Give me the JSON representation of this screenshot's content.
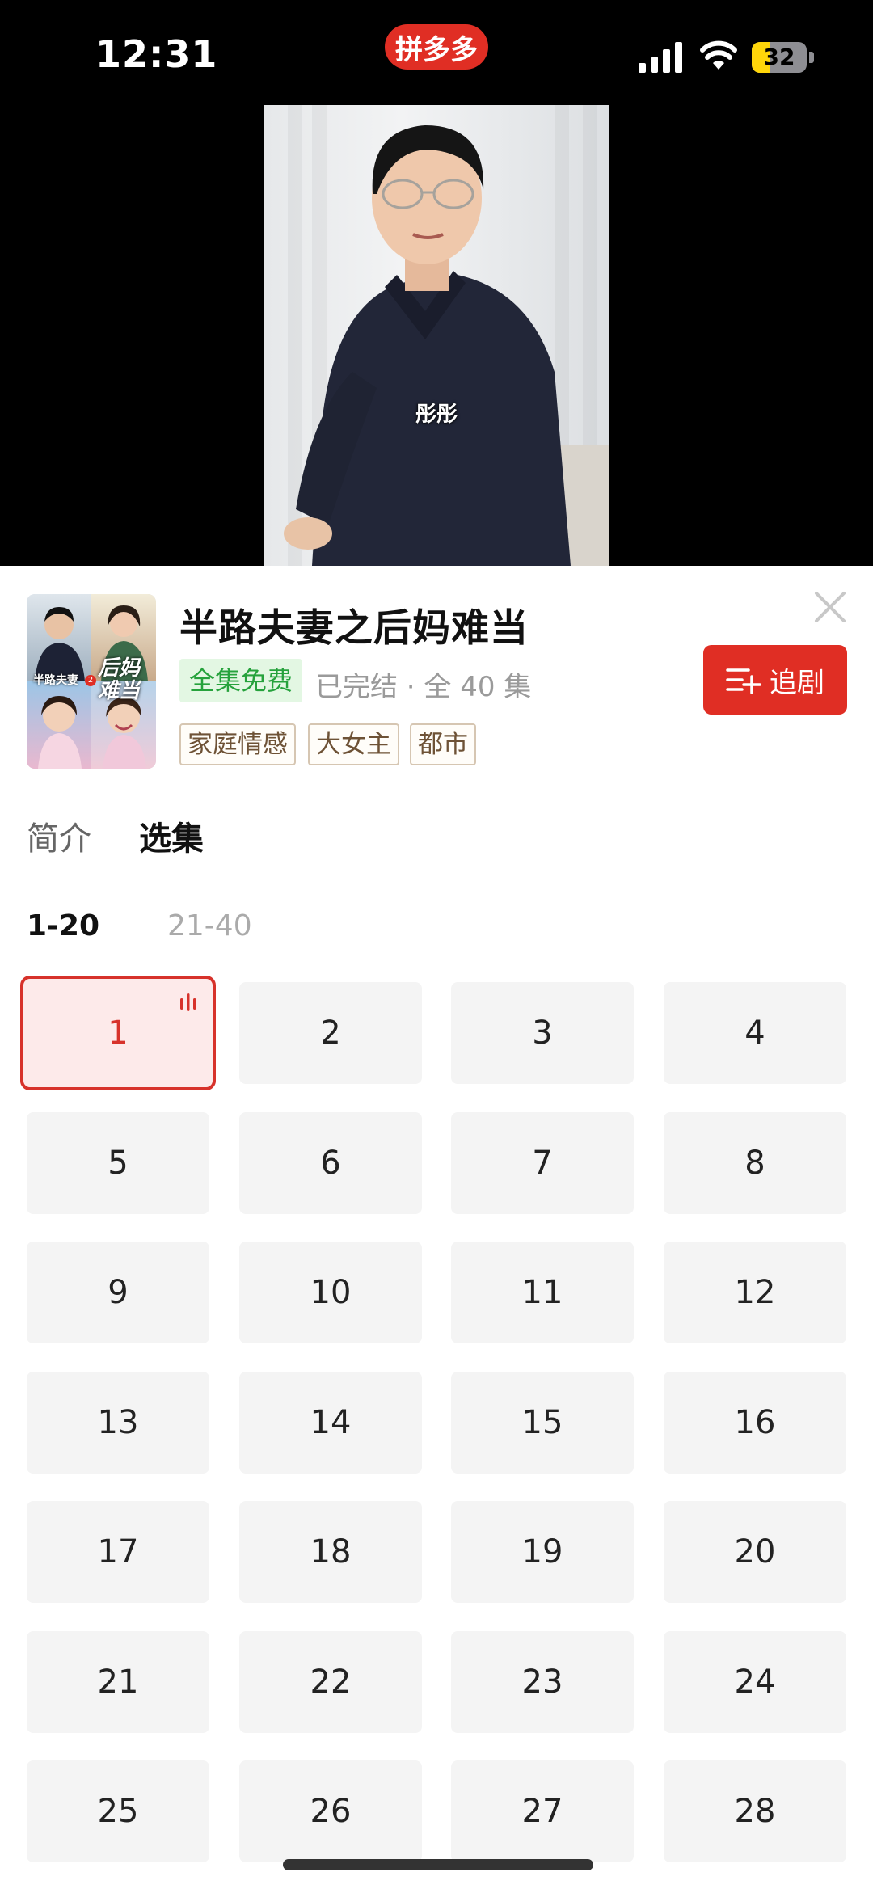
{
  "status_bar": {
    "time": "12:31",
    "app_badge": "拼多多",
    "battery": "32",
    "battery_level": 0.32
  },
  "video": {
    "subtitle": "彤彤"
  },
  "drama": {
    "title": "半路夫妻之后妈难当",
    "free_label": "全集免费",
    "status": "已完结 · 全 40 集",
    "tags": [
      "家庭情感",
      "大女主",
      "都市"
    ],
    "follow_label": "追剧",
    "poster_text": "半路夫妻",
    "poster_title": "后妈难当",
    "poster_number": "2"
  },
  "tabs": {
    "intro": "简介",
    "episodes": "选集"
  },
  "ranges": [
    "1-20",
    "21-40"
  ],
  "episodes": [
    "1",
    "2",
    "3",
    "4",
    "5",
    "6",
    "7",
    "8",
    "9",
    "10",
    "11",
    "12",
    "13",
    "14",
    "15",
    "16",
    "17",
    "18",
    "19",
    "20",
    "21",
    "22",
    "23",
    "24",
    "25",
    "26",
    "27",
    "28"
  ],
  "current_episode": "1",
  "colors": {
    "accent": "#e02e24",
    "free_green": "#26a23c"
  }
}
